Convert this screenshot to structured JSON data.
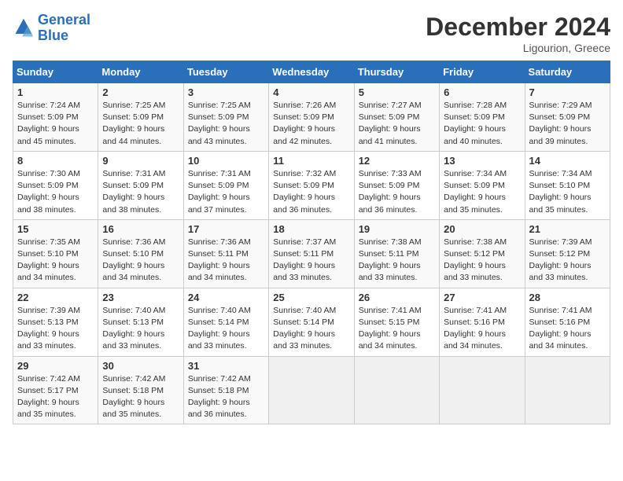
{
  "header": {
    "logo_line1": "General",
    "logo_line2": "Blue",
    "month": "December 2024",
    "location": "Ligourion, Greece"
  },
  "weekdays": [
    "Sunday",
    "Monday",
    "Tuesday",
    "Wednesday",
    "Thursday",
    "Friday",
    "Saturday"
  ],
  "weeks": [
    [
      {
        "day": 1,
        "sunrise": "7:24 AM",
        "sunset": "5:09 PM",
        "daylight": "9 hours and 45 minutes."
      },
      {
        "day": 2,
        "sunrise": "7:25 AM",
        "sunset": "5:09 PM",
        "daylight": "9 hours and 44 minutes."
      },
      {
        "day": 3,
        "sunrise": "7:25 AM",
        "sunset": "5:09 PM",
        "daylight": "9 hours and 43 minutes."
      },
      {
        "day": 4,
        "sunrise": "7:26 AM",
        "sunset": "5:09 PM",
        "daylight": "9 hours and 42 minutes."
      },
      {
        "day": 5,
        "sunrise": "7:27 AM",
        "sunset": "5:09 PM",
        "daylight": "9 hours and 41 minutes."
      },
      {
        "day": 6,
        "sunrise": "7:28 AM",
        "sunset": "5:09 PM",
        "daylight": "9 hours and 40 minutes."
      },
      {
        "day": 7,
        "sunrise": "7:29 AM",
        "sunset": "5:09 PM",
        "daylight": "9 hours and 39 minutes."
      }
    ],
    [
      {
        "day": 8,
        "sunrise": "7:30 AM",
        "sunset": "5:09 PM",
        "daylight": "9 hours and 38 minutes."
      },
      {
        "day": 9,
        "sunrise": "7:31 AM",
        "sunset": "5:09 PM",
        "daylight": "9 hours and 38 minutes."
      },
      {
        "day": 10,
        "sunrise": "7:31 AM",
        "sunset": "5:09 PM",
        "daylight": "9 hours and 37 minutes."
      },
      {
        "day": 11,
        "sunrise": "7:32 AM",
        "sunset": "5:09 PM",
        "daylight": "9 hours and 36 minutes."
      },
      {
        "day": 12,
        "sunrise": "7:33 AM",
        "sunset": "5:09 PM",
        "daylight": "9 hours and 36 minutes."
      },
      {
        "day": 13,
        "sunrise": "7:34 AM",
        "sunset": "5:09 PM",
        "daylight": "9 hours and 35 minutes."
      },
      {
        "day": 14,
        "sunrise": "7:34 AM",
        "sunset": "5:10 PM",
        "daylight": "9 hours and 35 minutes."
      }
    ],
    [
      {
        "day": 15,
        "sunrise": "7:35 AM",
        "sunset": "5:10 PM",
        "daylight": "9 hours and 34 minutes."
      },
      {
        "day": 16,
        "sunrise": "7:36 AM",
        "sunset": "5:10 PM",
        "daylight": "9 hours and 34 minutes."
      },
      {
        "day": 17,
        "sunrise": "7:36 AM",
        "sunset": "5:11 PM",
        "daylight": "9 hours and 34 minutes."
      },
      {
        "day": 18,
        "sunrise": "7:37 AM",
        "sunset": "5:11 PM",
        "daylight": "9 hours and 33 minutes."
      },
      {
        "day": 19,
        "sunrise": "7:38 AM",
        "sunset": "5:11 PM",
        "daylight": "9 hours and 33 minutes."
      },
      {
        "day": 20,
        "sunrise": "7:38 AM",
        "sunset": "5:12 PM",
        "daylight": "9 hours and 33 minutes."
      },
      {
        "day": 21,
        "sunrise": "7:39 AM",
        "sunset": "5:12 PM",
        "daylight": "9 hours and 33 minutes."
      }
    ],
    [
      {
        "day": 22,
        "sunrise": "7:39 AM",
        "sunset": "5:13 PM",
        "daylight": "9 hours and 33 minutes."
      },
      {
        "day": 23,
        "sunrise": "7:40 AM",
        "sunset": "5:13 PM",
        "daylight": "9 hours and 33 minutes."
      },
      {
        "day": 24,
        "sunrise": "7:40 AM",
        "sunset": "5:14 PM",
        "daylight": "9 hours and 33 minutes."
      },
      {
        "day": 25,
        "sunrise": "7:40 AM",
        "sunset": "5:14 PM",
        "daylight": "9 hours and 33 minutes."
      },
      {
        "day": 26,
        "sunrise": "7:41 AM",
        "sunset": "5:15 PM",
        "daylight": "9 hours and 34 minutes."
      },
      {
        "day": 27,
        "sunrise": "7:41 AM",
        "sunset": "5:16 PM",
        "daylight": "9 hours and 34 minutes."
      },
      {
        "day": 28,
        "sunrise": "7:41 AM",
        "sunset": "5:16 PM",
        "daylight": "9 hours and 34 minutes."
      }
    ],
    [
      {
        "day": 29,
        "sunrise": "7:42 AM",
        "sunset": "5:17 PM",
        "daylight": "9 hours and 35 minutes."
      },
      {
        "day": 30,
        "sunrise": "7:42 AM",
        "sunset": "5:18 PM",
        "daylight": "9 hours and 35 minutes."
      },
      {
        "day": 31,
        "sunrise": "7:42 AM",
        "sunset": "5:18 PM",
        "daylight": "9 hours and 36 minutes."
      },
      null,
      null,
      null,
      null
    ]
  ]
}
